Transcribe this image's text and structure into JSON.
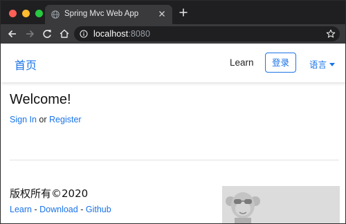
{
  "browser": {
    "tab_title": "Spring Mvc Web App",
    "url_host": "localhost",
    "url_port": ":8080"
  },
  "navbar": {
    "brand": "首页",
    "learn": "Learn",
    "login": "登录",
    "language": "语言"
  },
  "main": {
    "welcome": "Welcome!",
    "sign_in": "Sign In",
    "or": "or",
    "register": "Register"
  },
  "footer": {
    "copyright": "版权所有©2020",
    "links": {
      "learn": "Learn",
      "download": "Download",
      "github": "Github",
      "separator": "-"
    }
  },
  "colors": {
    "accent": "#1a73e8",
    "chrome_dark": "#1f1f21",
    "chrome_toolbar": "#3a3a3d"
  },
  "icons": [
    "globe-icon",
    "close-icon",
    "plus-icon",
    "back-arrow-icon",
    "forward-arrow-icon",
    "reload-icon",
    "home-icon",
    "info-icon",
    "star-icon",
    "caret-down-icon",
    "monkey-mascot-image"
  ]
}
